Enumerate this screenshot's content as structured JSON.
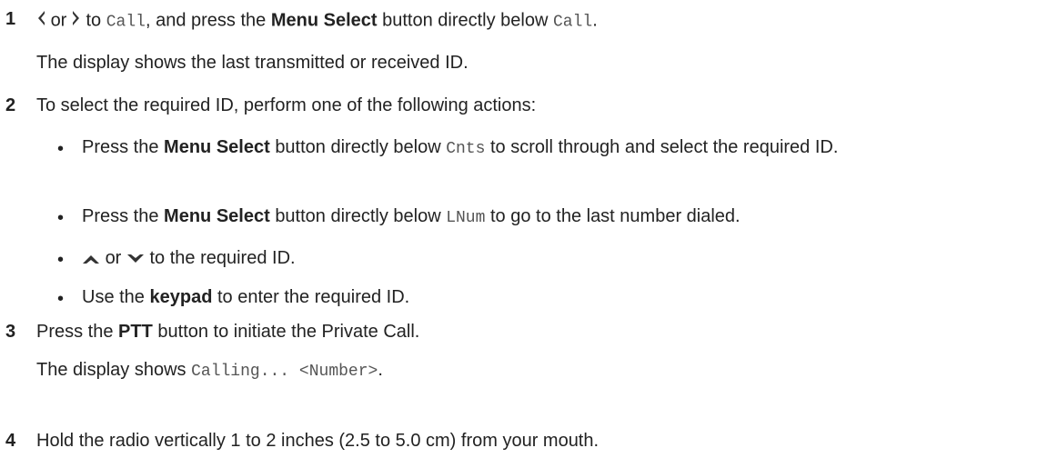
{
  "step1": {
    "number": "1",
    "or": "or",
    "to": "to",
    "call1": "Call",
    "press_the": ", and press the",
    "menu_select": "Menu Select",
    "directly_below": "button directly below",
    "call2": "Call",
    "period": ".",
    "result": "The display shows the last transmitted or received ID."
  },
  "step2": {
    "number": "2",
    "text": "To select the required ID, perform one of the following actions:",
    "bullets": [
      {
        "pre": "Press the",
        "bold": "Menu Select",
        "mid": "button directly below",
        "code": "Cnts",
        "post": "to scroll through and select the required ID."
      },
      {
        "pre": "Press the",
        "bold": "Menu Select",
        "mid": "button directly below",
        "code": "LNum",
        "post": "to go to the last number dialed."
      },
      {
        "or": "or",
        "post": "to the required ID."
      },
      {
        "pre": "Use the",
        "bold": "keypad",
        "post": "to enter the required ID."
      }
    ]
  },
  "step3": {
    "number": "3",
    "pre": "Press the",
    "bold": "PTT",
    "post": "button to initiate the Private Call.",
    "result_pre": "The display shows",
    "result_code": "Calling... <Number>",
    "result_post": "."
  },
  "step4": {
    "number": "4",
    "text": "Hold the radio vertically 1 to 2 inches (2.5 to 5.0 cm) from your mouth."
  }
}
